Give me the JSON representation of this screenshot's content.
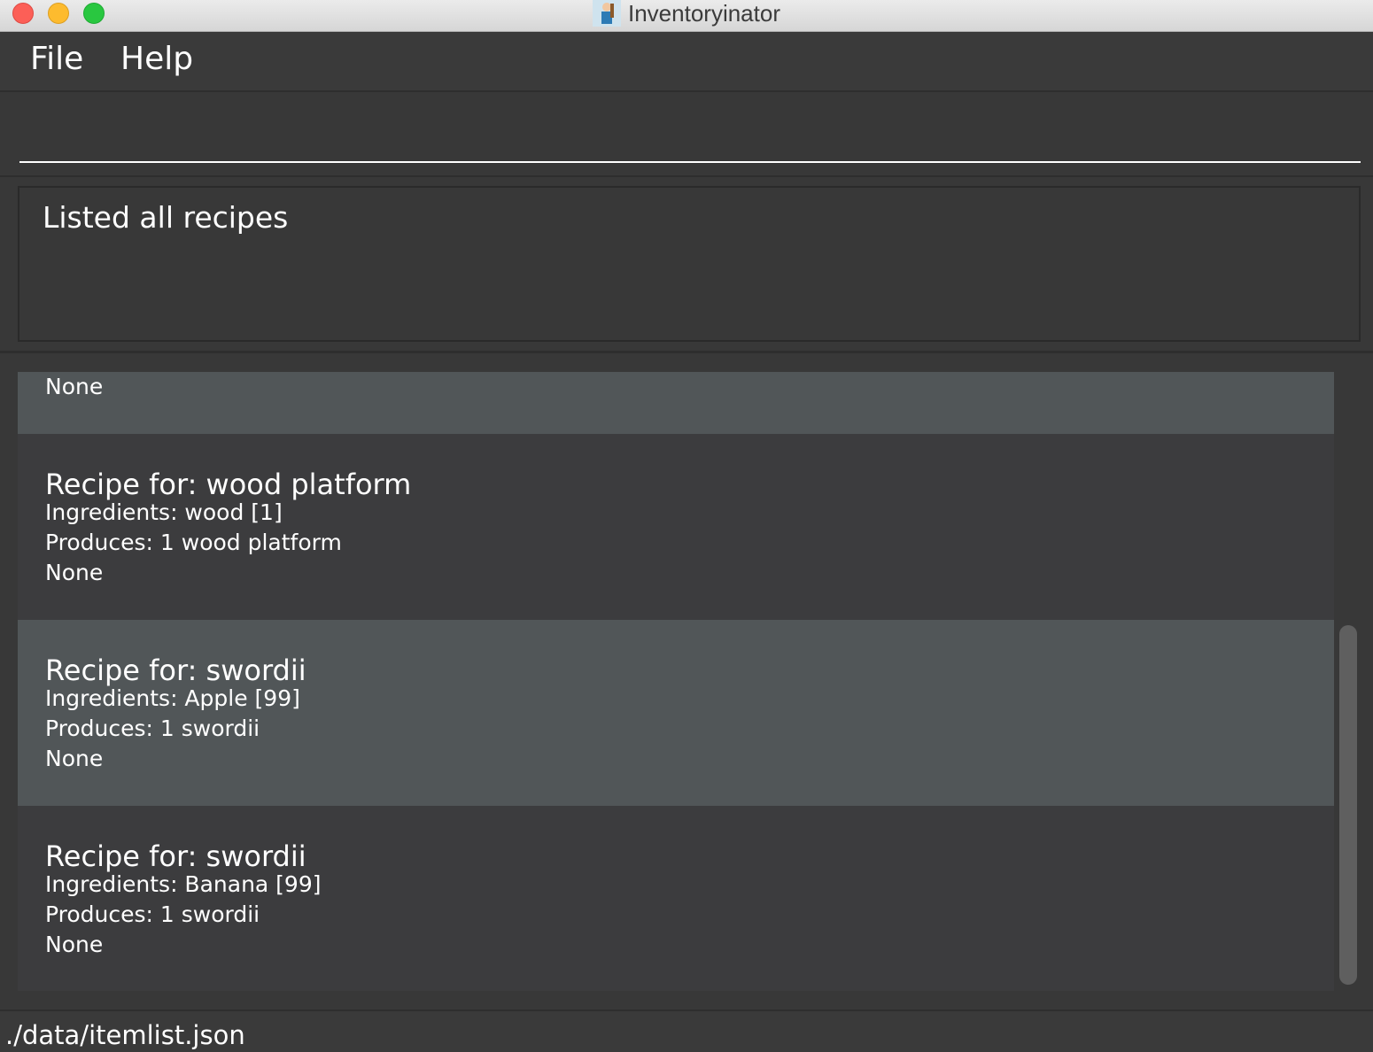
{
  "window": {
    "title": "Inventoryinator",
    "app_icon": "inventoryinator-app-icon"
  },
  "menu": {
    "items": [
      "File",
      "Help"
    ]
  },
  "command": {
    "value": "",
    "placeholder": ""
  },
  "result": {
    "message": "Listed all recipes"
  },
  "recipes": [
    {
      "name": "",
      "ingredients": "",
      "produces": "",
      "note": "None"
    },
    {
      "name": "Recipe for: wood platform",
      "ingredients": "Ingredients: wood [1]",
      "produces": "Produces: 1 wood platform",
      "note": "None"
    },
    {
      "name": "Recipe for: swordii",
      "ingredients": "Ingredients: Apple [99]",
      "produces": "Produces: 1 swordii",
      "note": "None"
    },
    {
      "name": "Recipe for: swordii",
      "ingredients": "Ingredients: Banana [99]",
      "produces": "Produces: 1 swordii",
      "note": "None"
    }
  ],
  "status": {
    "path": "./data/itemlist.json"
  },
  "colors": {
    "background": "#383838",
    "card_highlight": "#515658",
    "card_default": "#3c3c3e",
    "text": "#ffffff"
  }
}
